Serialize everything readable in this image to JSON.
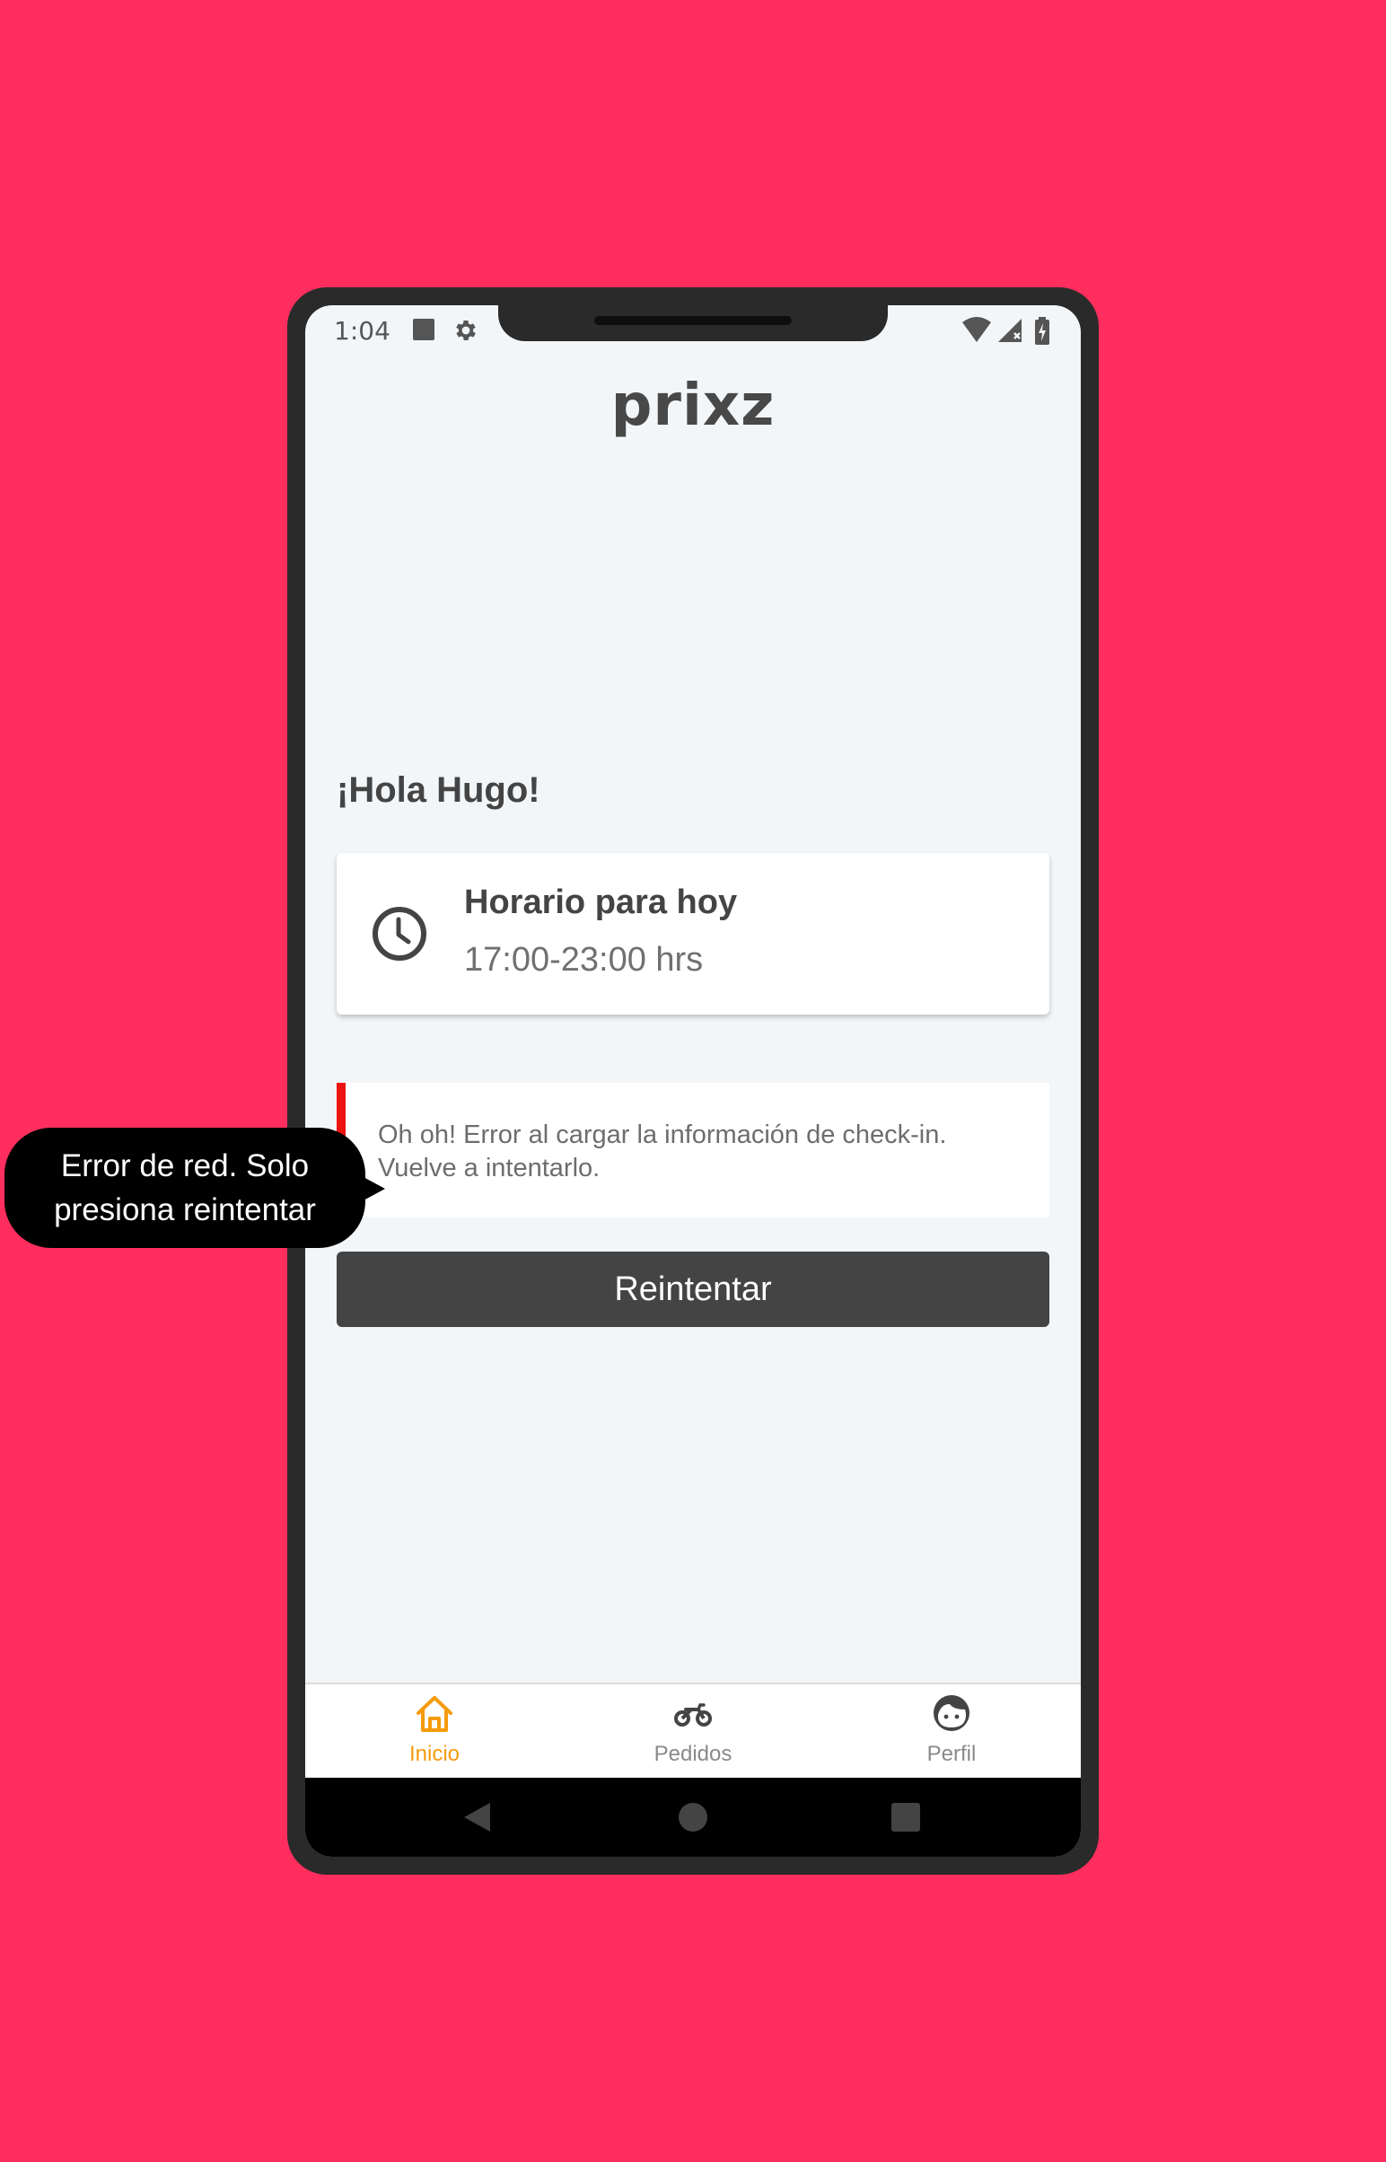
{
  "status_bar": {
    "time": "1:04",
    "icons": [
      "storage-square-icon",
      "gear-icon",
      "wifi-icon",
      "signal-icon",
      "battery-charging-icon"
    ]
  },
  "header": {
    "logo_text": "prixz"
  },
  "greeting": "¡Hola Hugo!",
  "schedule": {
    "icon": "clock-icon",
    "title": "Horario para hoy",
    "hours": "17:00-23:00 hrs"
  },
  "error": {
    "message": "Oh oh! Error al cargar la información de check-in. Vuelve a intentarlo."
  },
  "retry_button": {
    "label": "Reintentar"
  },
  "bottom_nav": {
    "items": [
      {
        "label": "Inicio",
        "icon": "home-icon",
        "active": true
      },
      {
        "label": "Pedidos",
        "icon": "motorcycle-icon",
        "active": false
      },
      {
        "label": "Perfil",
        "icon": "face-icon",
        "active": false
      }
    ]
  },
  "tooltip": {
    "line1": "Error de red. Solo",
    "line2": "presiona reintentar"
  },
  "colors": {
    "background": "#FF2E5E",
    "accent": "#F59B0C",
    "error": "#EE1111",
    "button": "#444444",
    "screen": "#F2F6F9"
  }
}
